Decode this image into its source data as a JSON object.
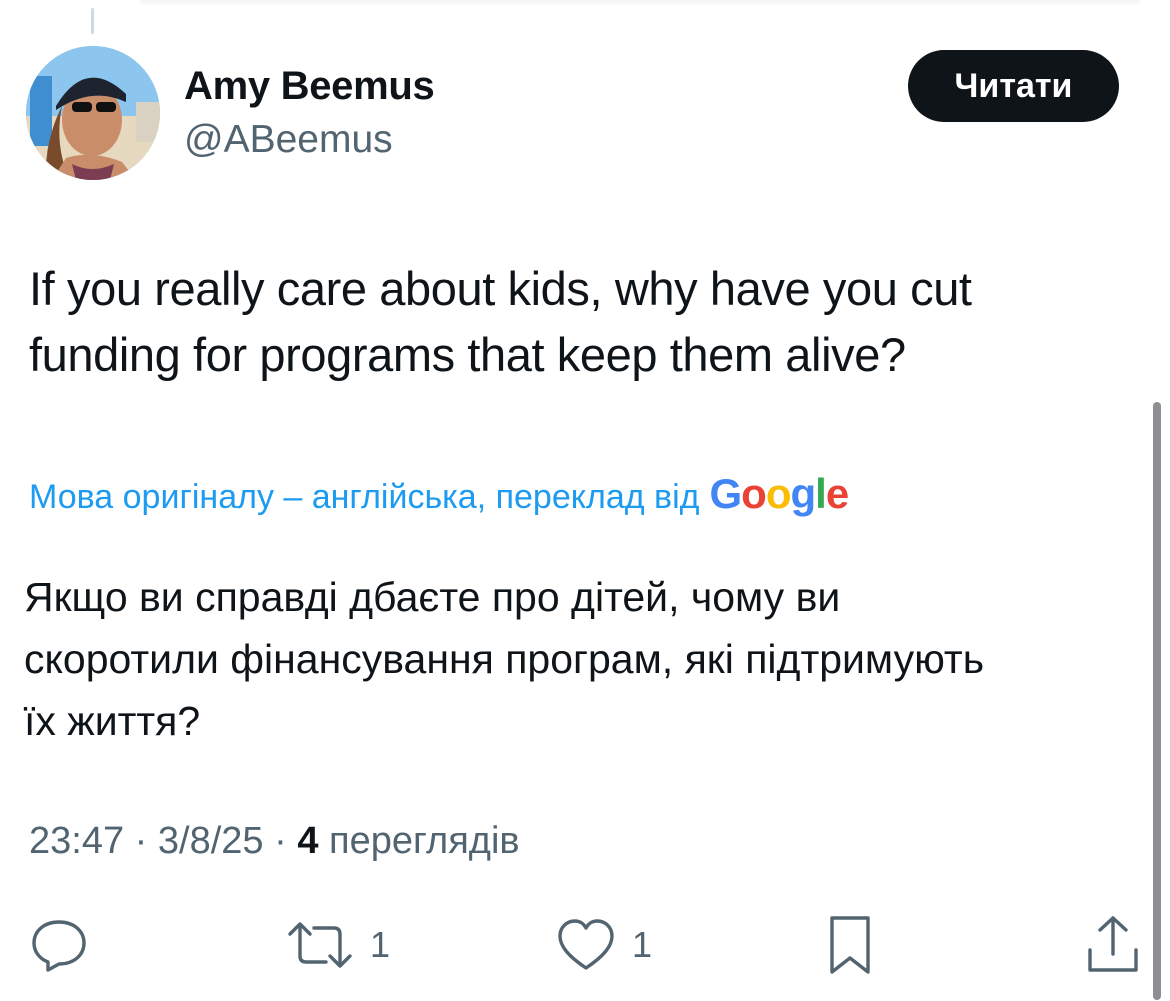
{
  "author": {
    "display_name": "Amy Beemus",
    "handle": "@ABeemus"
  },
  "follow_button": {
    "label": "Читати"
  },
  "tweet": {
    "text_line1": "If you really care about kids, why have you cut",
    "text_line2": "funding for programs that keep them alive?"
  },
  "translation": {
    "note": "Мова оригіналу – англійська, переклад від",
    "provider": [
      "G",
      "o",
      "o",
      "g",
      "l",
      "e"
    ],
    "line1": "Якщо ви справді дбаєте про дітей, чому ви",
    "line2": "скоротили фінансування програм, які підтримують",
    "line3": "їх життя?"
  },
  "meta": {
    "time": "23:47",
    "date": "3/8/25",
    "separator": "·",
    "views_count": "4",
    "views_label": "переглядів"
  },
  "actions": {
    "reply_icon": "reply-icon",
    "retweet_icon": "retweet-icon",
    "retweet_count": "1",
    "like_icon": "heart-icon",
    "like_count": "1",
    "bookmark_icon": "bookmark-icon",
    "share_icon": "share-icon"
  },
  "colors": {
    "accent": "#1d9bf0",
    "text": "#0f1419",
    "muted": "#536471",
    "button_bg": "#0f1419"
  }
}
